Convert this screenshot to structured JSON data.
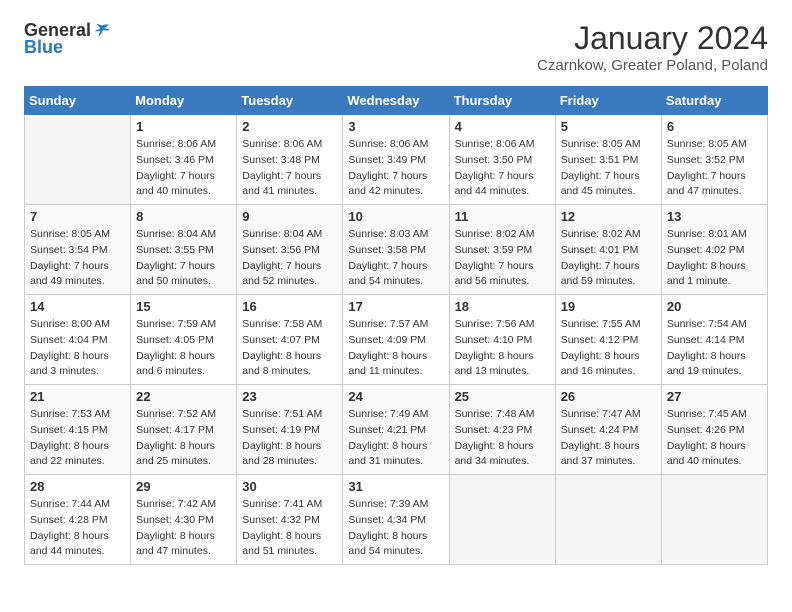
{
  "header": {
    "logo_general": "General",
    "logo_blue": "Blue",
    "title": "January 2024",
    "location": "Czarnkow, Greater Poland, Poland"
  },
  "weekdays": [
    "Sunday",
    "Monday",
    "Tuesday",
    "Wednesday",
    "Thursday",
    "Friday",
    "Saturday"
  ],
  "weeks": [
    [
      {
        "day": "",
        "empty": true
      },
      {
        "day": "1",
        "sunrise": "8:06 AM",
        "sunset": "3:46 PM",
        "daylight": "7 hours and 40 minutes."
      },
      {
        "day": "2",
        "sunrise": "8:06 AM",
        "sunset": "3:48 PM",
        "daylight": "7 hours and 41 minutes."
      },
      {
        "day": "3",
        "sunrise": "8:06 AM",
        "sunset": "3:49 PM",
        "daylight": "7 hours and 42 minutes."
      },
      {
        "day": "4",
        "sunrise": "8:06 AM",
        "sunset": "3:50 PM",
        "daylight": "7 hours and 44 minutes."
      },
      {
        "day": "5",
        "sunrise": "8:05 AM",
        "sunset": "3:51 PM",
        "daylight": "7 hours and 45 minutes."
      },
      {
        "day": "6",
        "sunrise": "8:05 AM",
        "sunset": "3:52 PM",
        "daylight": "7 hours and 47 minutes."
      }
    ],
    [
      {
        "day": "7",
        "sunrise": "8:05 AM",
        "sunset": "3:54 PM",
        "daylight": "7 hours and 49 minutes."
      },
      {
        "day": "8",
        "sunrise": "8:04 AM",
        "sunset": "3:55 PM",
        "daylight": "7 hours and 50 minutes."
      },
      {
        "day": "9",
        "sunrise": "8:04 AM",
        "sunset": "3:56 PM",
        "daylight": "7 hours and 52 minutes."
      },
      {
        "day": "10",
        "sunrise": "8:03 AM",
        "sunset": "3:58 PM",
        "daylight": "7 hours and 54 minutes."
      },
      {
        "day": "11",
        "sunrise": "8:02 AM",
        "sunset": "3:59 PM",
        "daylight": "7 hours and 56 minutes."
      },
      {
        "day": "12",
        "sunrise": "8:02 AM",
        "sunset": "4:01 PM",
        "daylight": "7 hours and 59 minutes."
      },
      {
        "day": "13",
        "sunrise": "8:01 AM",
        "sunset": "4:02 PM",
        "daylight": "8 hours and 1 minute."
      }
    ],
    [
      {
        "day": "14",
        "sunrise": "8:00 AM",
        "sunset": "4:04 PM",
        "daylight": "8 hours and 3 minutes."
      },
      {
        "day": "15",
        "sunrise": "7:59 AM",
        "sunset": "4:05 PM",
        "daylight": "8 hours and 6 minutes."
      },
      {
        "day": "16",
        "sunrise": "7:58 AM",
        "sunset": "4:07 PM",
        "daylight": "8 hours and 8 minutes."
      },
      {
        "day": "17",
        "sunrise": "7:57 AM",
        "sunset": "4:09 PM",
        "daylight": "8 hours and 11 minutes."
      },
      {
        "day": "18",
        "sunrise": "7:56 AM",
        "sunset": "4:10 PM",
        "daylight": "8 hours and 13 minutes."
      },
      {
        "day": "19",
        "sunrise": "7:55 AM",
        "sunset": "4:12 PM",
        "daylight": "8 hours and 16 minutes."
      },
      {
        "day": "20",
        "sunrise": "7:54 AM",
        "sunset": "4:14 PM",
        "daylight": "8 hours and 19 minutes."
      }
    ],
    [
      {
        "day": "21",
        "sunrise": "7:53 AM",
        "sunset": "4:15 PM",
        "daylight": "8 hours and 22 minutes."
      },
      {
        "day": "22",
        "sunrise": "7:52 AM",
        "sunset": "4:17 PM",
        "daylight": "8 hours and 25 minutes."
      },
      {
        "day": "23",
        "sunrise": "7:51 AM",
        "sunset": "4:19 PM",
        "daylight": "8 hours and 28 minutes."
      },
      {
        "day": "24",
        "sunrise": "7:49 AM",
        "sunset": "4:21 PM",
        "daylight": "8 hours and 31 minutes."
      },
      {
        "day": "25",
        "sunrise": "7:48 AM",
        "sunset": "4:23 PM",
        "daylight": "8 hours and 34 minutes."
      },
      {
        "day": "26",
        "sunrise": "7:47 AM",
        "sunset": "4:24 PM",
        "daylight": "8 hours and 37 minutes."
      },
      {
        "day": "27",
        "sunrise": "7:45 AM",
        "sunset": "4:26 PM",
        "daylight": "8 hours and 40 minutes."
      }
    ],
    [
      {
        "day": "28",
        "sunrise": "7:44 AM",
        "sunset": "4:28 PM",
        "daylight": "8 hours and 44 minutes."
      },
      {
        "day": "29",
        "sunrise": "7:42 AM",
        "sunset": "4:30 PM",
        "daylight": "8 hours and 47 minutes."
      },
      {
        "day": "30",
        "sunrise": "7:41 AM",
        "sunset": "4:32 PM",
        "daylight": "8 hours and 51 minutes."
      },
      {
        "day": "31",
        "sunrise": "7:39 AM",
        "sunset": "4:34 PM",
        "daylight": "8 hours and 54 minutes."
      },
      {
        "day": "",
        "empty": true
      },
      {
        "day": "",
        "empty": true
      },
      {
        "day": "",
        "empty": true
      }
    ]
  ]
}
